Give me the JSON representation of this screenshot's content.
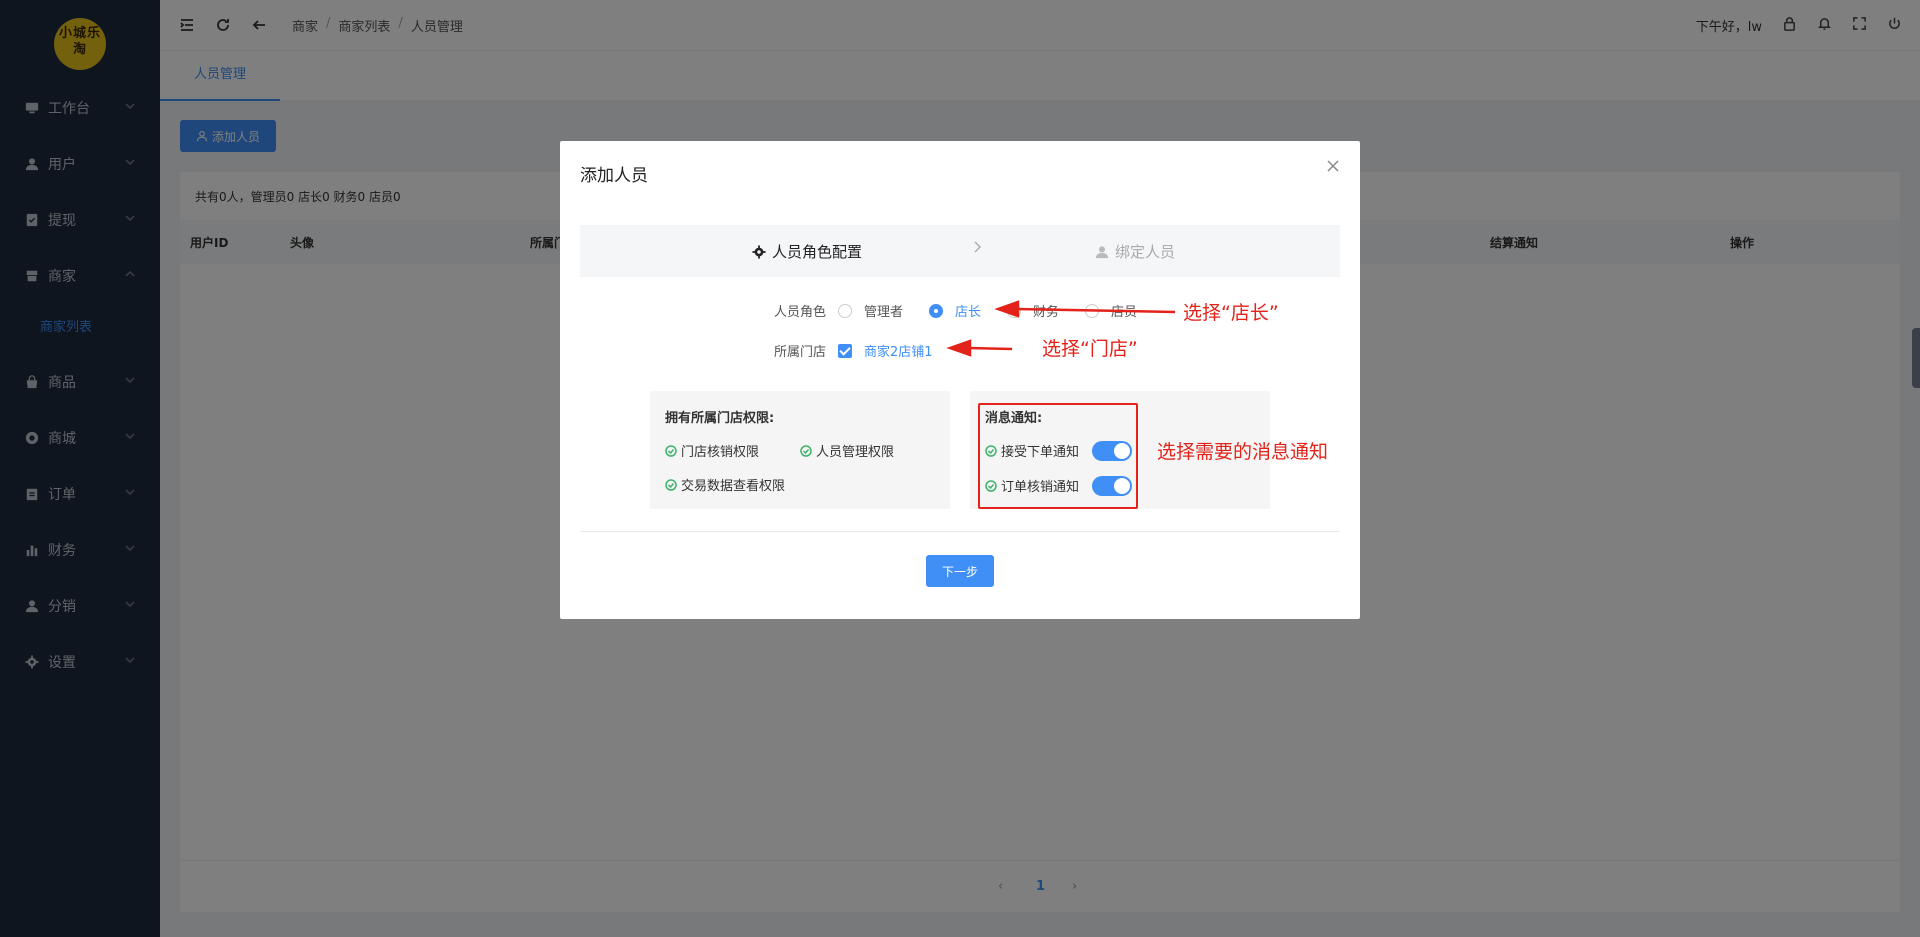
{
  "logo": {
    "text": "小城乐淘"
  },
  "sidebar": {
    "items": [
      {
        "label": "工作台",
        "icon": "monitor-icon"
      },
      {
        "label": "用户",
        "icon": "user-icon"
      },
      {
        "label": "提现",
        "icon": "checklist-icon"
      },
      {
        "label": "商家",
        "icon": "store-icon"
      },
      {
        "label": "商品",
        "icon": "bag-icon"
      },
      {
        "label": "商城",
        "icon": "shop-icon"
      },
      {
        "label": "订单",
        "icon": "clipboard-icon"
      },
      {
        "label": "财务",
        "icon": "bar-chart-icon"
      },
      {
        "label": "分销",
        "icon": "user-icon"
      },
      {
        "label": "设置",
        "icon": "gear-icon"
      }
    ],
    "sub_active": "商家列表"
  },
  "topbar": {
    "breadcrumb": [
      "商家",
      "商家列表",
      "人员管理"
    ],
    "greeting": "下午好，lw"
  },
  "tabs": {
    "active": "人员管理"
  },
  "page": {
    "add_button": "添加人员",
    "summary": "共有0人，管理员0 店长0 财务0 店员0",
    "columns": [
      "用户ID",
      "头像",
      "所属门",
      "结算通知",
      "操作"
    ],
    "pager_current": "1"
  },
  "modal": {
    "title": "添加人员",
    "step1": "人员角色配置",
    "step2": "绑定人员",
    "role_label": "人员角色",
    "roles": [
      "管理者",
      "店长",
      "财务",
      "店员"
    ],
    "role_selected": "店长",
    "store_label": "所属门店",
    "store_value": "商家2店铺1",
    "perm_title": "拥有所属门店权限:",
    "perms": [
      "门店核销权限",
      "人员管理权限",
      "交易数据查看权限"
    ],
    "notify_title": "消息通知:",
    "notify": [
      {
        "label": "接受下单通知",
        "on": true
      },
      {
        "label": "订单核销通知",
        "on": true
      }
    ],
    "next_button": "下一步"
  },
  "annotations": {
    "role": "选择“店长”",
    "store": "选择“门店”",
    "notify": "选择需要的消息通知"
  },
  "colors": {
    "accent": "#3f8ff7",
    "sidebar_bg": "#1f2a3d",
    "annotation": "#e3231a"
  }
}
